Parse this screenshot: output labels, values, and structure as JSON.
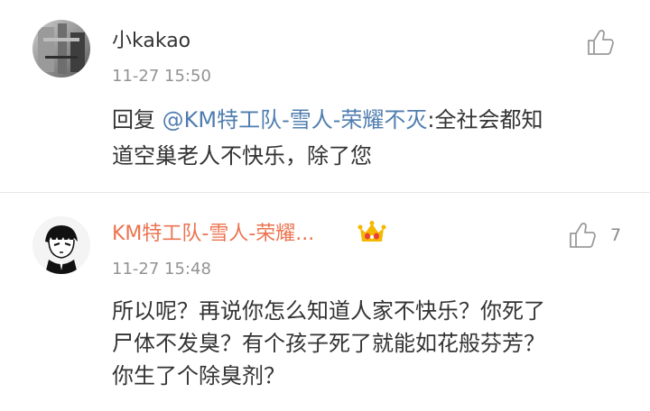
{
  "comments": [
    {
      "username": "小kakao",
      "timestamp": "11-27 15:50",
      "reply_prefix": "回复 ",
      "mention": "@KM特工队-雪人-荣耀不灭",
      "text_line1": ":全社会都知",
      "text_line2": "道空巢老人不快乐，除了您",
      "like_count": ""
    },
    {
      "username": "KM特工队-雪人-荣耀...",
      "timestamp": "11-27 15:48",
      "text_line1": "所以呢？再说你怎么知道人家不快乐？你死了",
      "text_line2": "尸体不发臭？有个孩子死了就能如花般芬芳？",
      "text_line3": "你生了个除臭剂？",
      "like_count": "7"
    }
  ],
  "colors": {
    "username_normal": "#333333",
    "username_vip": "#eb7350",
    "mention": "#507daf",
    "timestamp": "#939393"
  },
  "icons": [
    "thumbs-up-icon",
    "vip-crown-icon"
  ]
}
